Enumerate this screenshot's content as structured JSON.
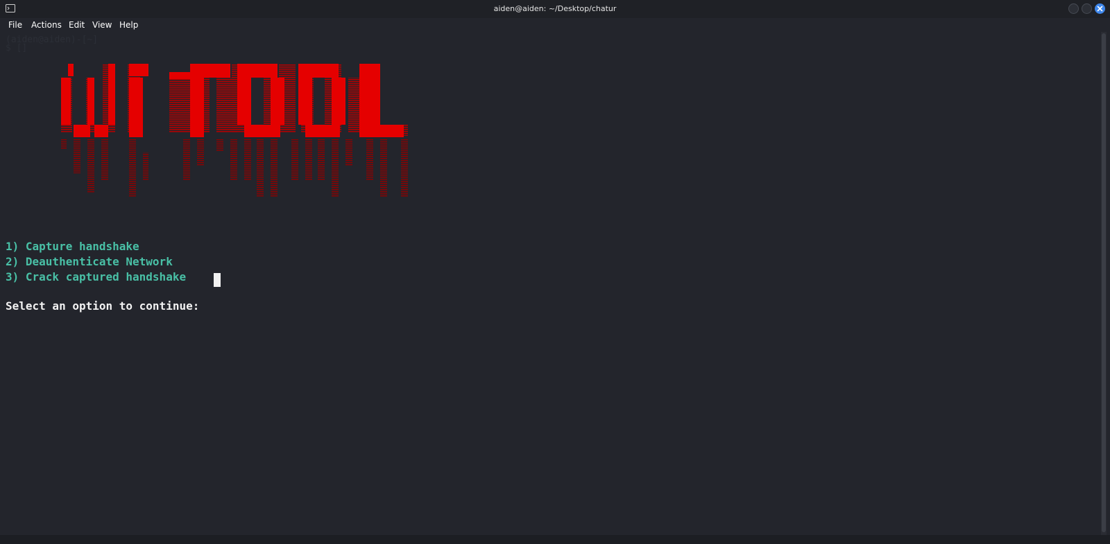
{
  "window": {
    "title": "aiden@aiden: ~/Desktop/chatur"
  },
  "menu": {
    "file": "File",
    "actions": "Actions",
    "edit": "Edit",
    "view": "View",
    "help": "Help"
  },
  "terminal": {
    "ghost_line_1": "(aiden@aiden)-[~]",
    "ghost_line_2": "$ []",
    "banner_color": "#e50000",
    "options": [
      "1) Capture handshake",
      "2) Deauthenticate Network",
      "3) Crack captured handshake"
    ],
    "prompt": "Select an option to continue: ",
    "option_color": "#49c0a6"
  },
  "icons": {
    "terminal": "terminal-icon",
    "minimize": "minimize-icon",
    "maximize": "maximize-icon",
    "close": "close-icon"
  },
  "colors": {
    "background": "#23252c",
    "accent": "#3e86ea"
  }
}
